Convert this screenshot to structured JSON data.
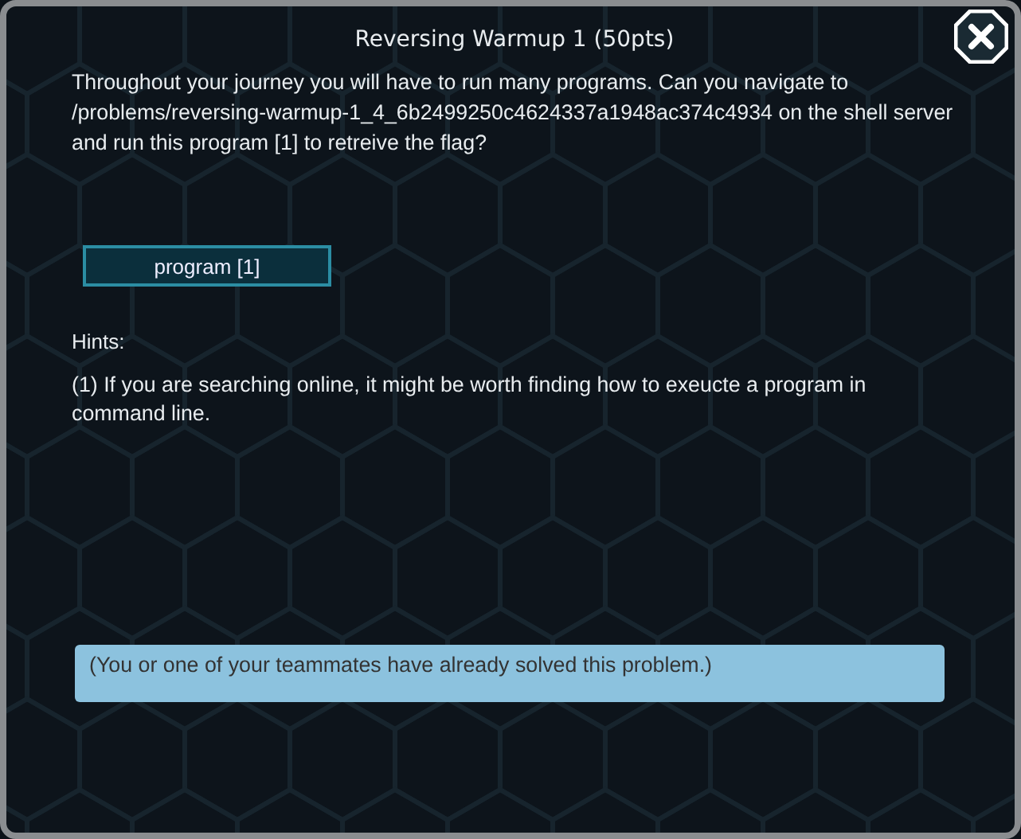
{
  "dialog": {
    "title": "Reversing Warmup 1 (50pts)",
    "description": "Throughout your journey you will have to run many programs. Can you navigate to /problems/reversing-warmup-1_4_6b2499250c4624337a1948ac374c4934 on the shell server and run this program [1]  to retreive the flag?",
    "buttons": [
      {
        "label": "program [1]"
      }
    ],
    "hints_label": "Hints:",
    "hints": [
      "(1) If you are searching online, it might be worth finding how to exeucte a program in command line."
    ],
    "status": {
      "kind": "info",
      "text": "(You or one of your teammates have already solved this problem.)"
    }
  }
}
